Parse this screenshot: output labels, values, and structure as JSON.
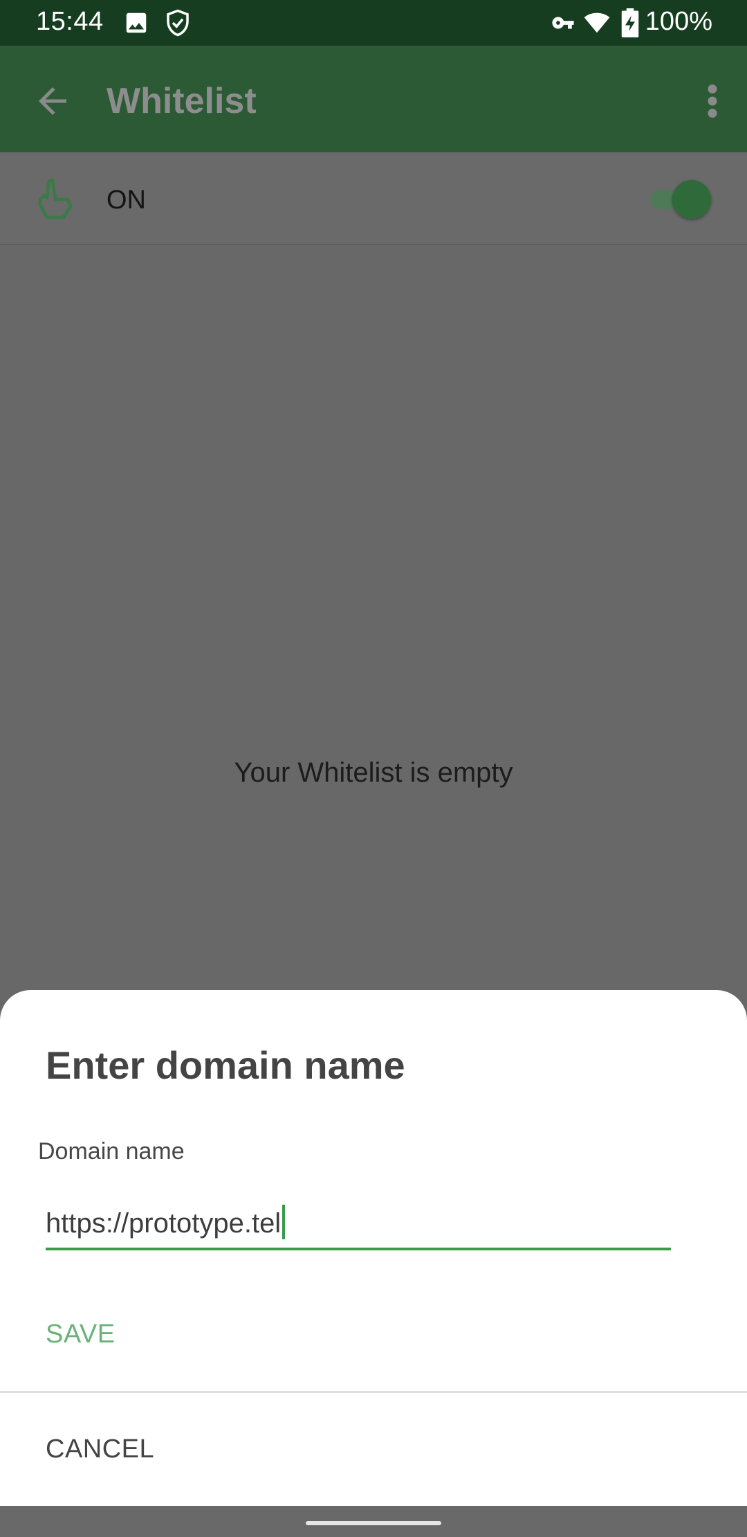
{
  "status_bar": {
    "time": "15:44",
    "battery_percent": "100%",
    "icons": [
      "image-icon",
      "shield-check-icon",
      "vpn-key-icon",
      "wifi-icon",
      "battery-charging-icon"
    ]
  },
  "app_bar": {
    "title": "Whitelist",
    "back_icon": "arrow-back-icon",
    "menu_icon": "more-vert-icon"
  },
  "toggle": {
    "label": "ON",
    "icon": "thumb-up-icon",
    "state": true
  },
  "main": {
    "empty_message": "Your Whitelist is empty"
  },
  "dialog": {
    "title": "Enter domain name",
    "field_label": "Domain name",
    "field_value": "https://prototype.tel",
    "save_label": "SAVE",
    "cancel_label": "CANCEL"
  },
  "colors": {
    "status_bar": "#173d21",
    "app_bar": "#2c5a35",
    "accent": "#3a9a4a",
    "save_text": "#6ab27a",
    "scrim": "#686868"
  }
}
